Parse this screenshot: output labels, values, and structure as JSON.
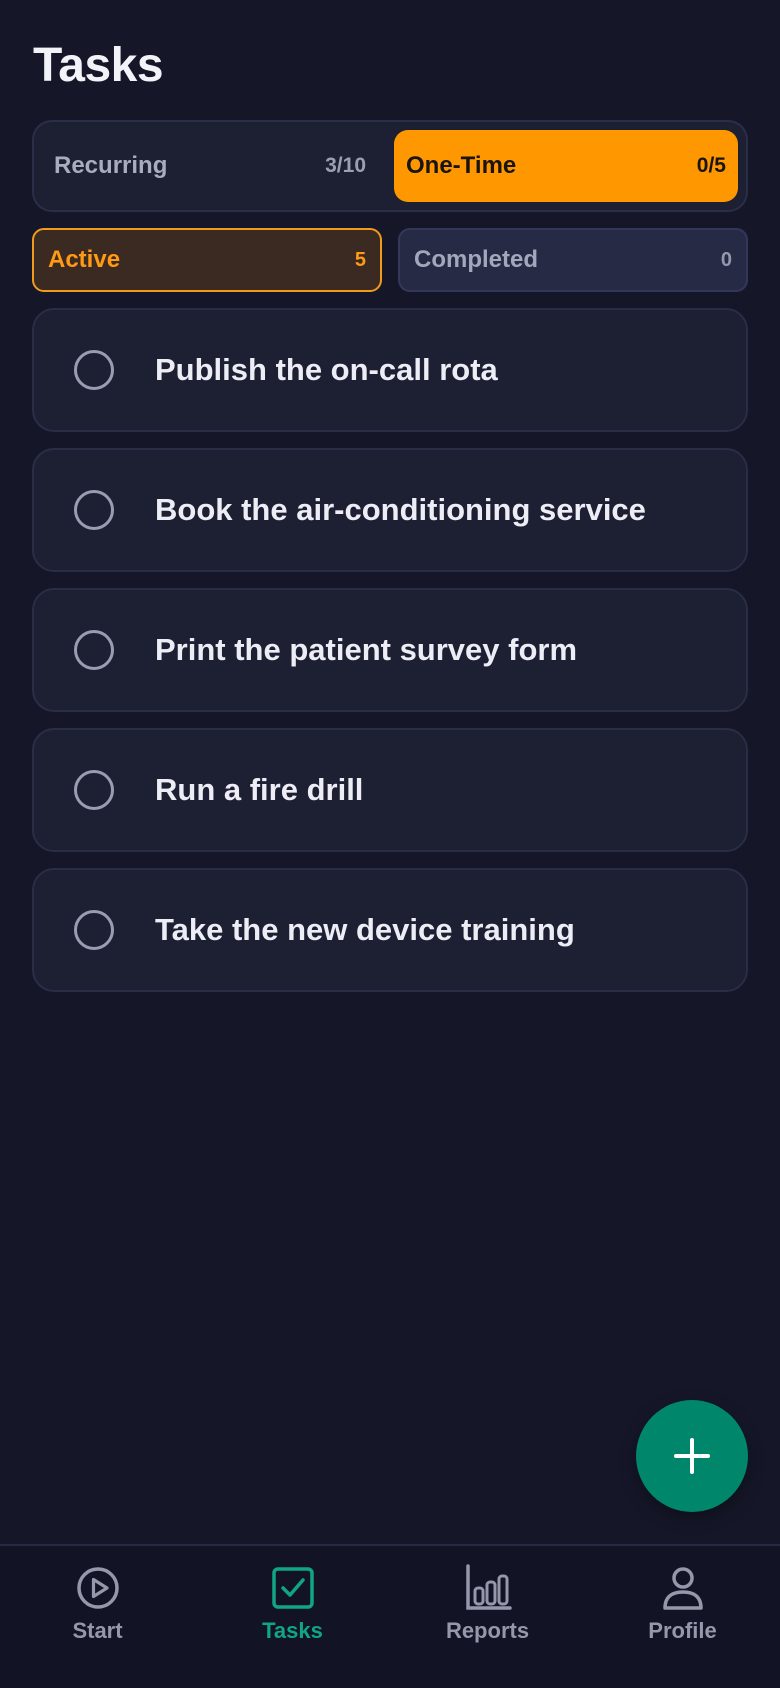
{
  "header": {
    "title": "Tasks"
  },
  "segment": {
    "options": [
      {
        "label": "Recurring",
        "count": "3/10",
        "selected": false
      },
      {
        "label": "One-Time",
        "count": "0/5",
        "selected": true
      }
    ]
  },
  "filters": [
    {
      "label": "Active",
      "count": "5",
      "selected": true
    },
    {
      "label": "Completed",
      "count": "0",
      "selected": false
    }
  ],
  "tasks": [
    {
      "label": "Publish the on-call rota",
      "done": false
    },
    {
      "label": "Book the air-conditioning service",
      "done": false
    },
    {
      "label": "Print the patient survey form",
      "done": false
    },
    {
      "label": "Run a fire drill",
      "done": false
    },
    {
      "label": "Take the new device training",
      "done": false
    }
  ],
  "fab": {
    "icon": "plus-icon"
  },
  "bottom_nav": [
    {
      "label": "Start",
      "icon": "play-circle-icon",
      "current": false
    },
    {
      "label": "Tasks",
      "icon": "checkbox-icon",
      "current": true
    },
    {
      "label": "Reports",
      "icon": "bar-chart-icon",
      "current": false
    },
    {
      "label": "Profile",
      "icon": "person-icon",
      "current": false
    }
  ],
  "colors": {
    "background": "#151729",
    "card": "#1D1F33",
    "accent_orange": "#FF9800",
    "accent_green": "#00866A",
    "nav_active": "#0FA585",
    "muted_text": "#9597AB"
  }
}
